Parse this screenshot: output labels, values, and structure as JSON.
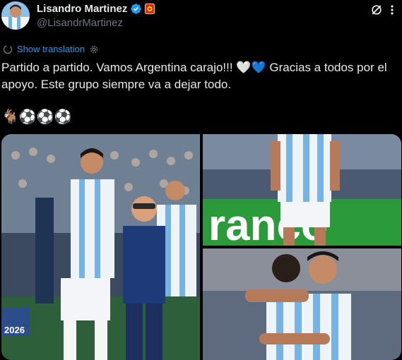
{
  "author": {
    "display_name": "Lisandro Martinez",
    "handle": "@LisandrMartinez"
  },
  "translation": {
    "label": "Show translation"
  },
  "tweet": {
    "line1": "Partido a partido. Vamos Argentina carajo!!! 🤍💙 Gracias a todos por el apoyo. Este grupo siempre va a dejar todo.",
    "emoji_line": "🐐⚽⚽⚽"
  },
  "media": {
    "photos": [
      {
        "scene_text": "2026"
      },
      {
        "scene_text": "ranco"
      },
      {
        "scene_text": ""
      }
    ]
  },
  "colors": {
    "accent": "#1d9bf0",
    "text": "#e7e9ea",
    "muted": "#71767b",
    "background": "#000000"
  },
  "icons": [
    "verified-icon",
    "club-badge-icon",
    "grok-icon",
    "more-icon",
    "translate-icon",
    "gear-icon"
  ]
}
